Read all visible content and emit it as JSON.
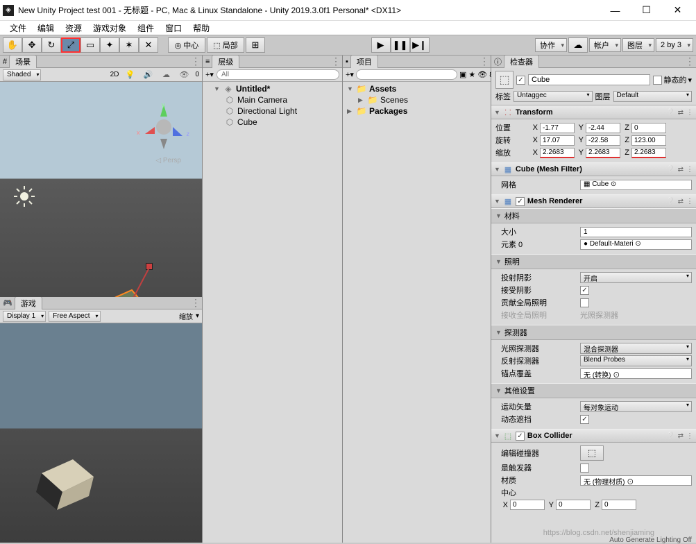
{
  "window": {
    "title": "New Unity Project test 001 - 无标题 - PC, Mac & Linux Standalone - Unity 2019.3.0f1 Personal* <DX11>"
  },
  "menubar": [
    "文件",
    "编辑",
    "资源",
    "游戏对象",
    "组件",
    "窗口",
    "帮助"
  ],
  "toolbar": {
    "center": "中心",
    "local": "局部",
    "collab": "协作",
    "account": "帐户",
    "layers": "图层",
    "layout": "2 by 3"
  },
  "scene": {
    "tab": "场景",
    "shaded": "Shaded",
    "mode2d": "2D",
    "persp": "Persp",
    "axes": {
      "x": "x",
      "y": "y",
      "z": "z"
    }
  },
  "game": {
    "tab": "游戏",
    "display": "Display 1",
    "aspect": "Free Aspect",
    "scale": "缩放"
  },
  "hierarchy": {
    "tab": "层级",
    "search_ph": "All",
    "scene_name": "Untitled*",
    "items": [
      "Main Camera",
      "Directional Light",
      "Cube"
    ]
  },
  "project": {
    "tab": "项目",
    "vis": "8",
    "assets": "Assets",
    "scenes": "Scenes",
    "packages": "Packages"
  },
  "inspector": {
    "tab": "检查器",
    "name": "Cube",
    "static": "静态的",
    "tag_label": "标签",
    "tag_value": "Untaggec",
    "layer_label": "图层",
    "layer_value": "Default",
    "transform": {
      "title": "Transform",
      "pos_lbl": "位置",
      "rot_lbl": "旋转",
      "scl_lbl": "缩放",
      "pos": {
        "x": "-1.77",
        "y": "-2.44",
        "z": "0"
      },
      "rot": {
        "x": "17.07",
        "y": "-22.58",
        "z": "123.00"
      },
      "scl": {
        "x": "2.2683",
        "y": "2.2683",
        "z": "2.2683"
      }
    },
    "meshfilter": {
      "title": "Cube (Mesh Filter)",
      "mesh_lbl": "网格",
      "mesh_val": "Cube"
    },
    "renderer": {
      "title": "Mesh Renderer",
      "mat_hdr": "材料",
      "size_lbl": "大小",
      "size_val": "1",
      "elem_lbl": "元素 0",
      "elem_val": "Default-Materi",
      "light_hdr": "照明",
      "cast_lbl": "投射阴影",
      "cast_val": "开启",
      "recv_lbl": "接受阴影",
      "gi_lbl": "贡献全局照明",
      "gi2_lbl": "接收全局照明",
      "gi2_val": "光照探测器",
      "probe_hdr": "探测器",
      "lp_lbl": "光照探测器",
      "lp_val": "混合探测器",
      "rp_lbl": "反射探测器",
      "rp_val": "Blend Probes",
      "anchor_lbl": "锚点覆盖",
      "anchor_val": "无 (转换)",
      "other_hdr": "其他设置",
      "motion_lbl": "运动矢量",
      "motion_val": "每对象运动",
      "dyn_lbl": "动态遮挡"
    },
    "collider": {
      "title": "Box Collider",
      "edit_lbl": "编辑碰撞器",
      "trigger_lbl": "是触发器",
      "mat_lbl": "材质",
      "mat_val": "无 (物理材质)",
      "center_lbl": "中心",
      "center": {
        "x": "0",
        "y": "0",
        "z": "0"
      }
    }
  },
  "status": "Auto Generate Lighting Off",
  "watermark": "https://blog.csdn.net/shenjiaming"
}
